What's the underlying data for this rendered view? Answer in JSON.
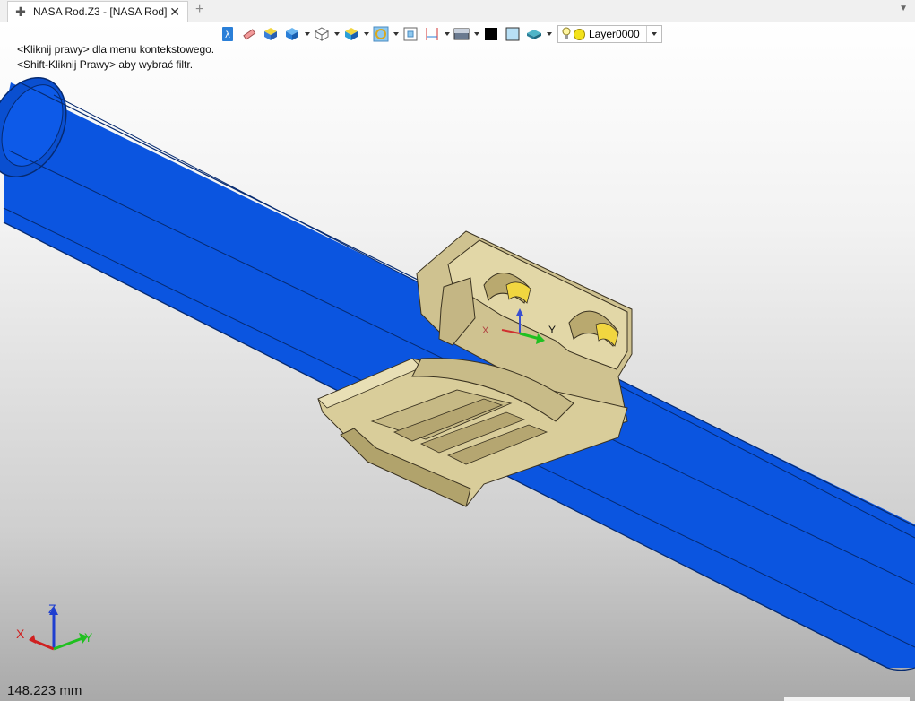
{
  "tab": {
    "title": "NASA Rod.Z3 - [NASA Rod]",
    "pin_icon": "plus-pin-icon",
    "close_icon": "close-icon",
    "new_tab_icon": "plus-icon"
  },
  "toolbar": {
    "buttons": [
      "walk-view-icon",
      "eraser-icon",
      "shaded-solid-icon",
      "shaded-cube-icon",
      "wireframe-cube-icon",
      "section-cube-icon",
      "circle-view-icon",
      "zoom-fit-icon",
      "dimension-icon",
      "background-icon",
      "black-color-swatch",
      "light-blue-color-swatch",
      "surface-material-icon"
    ],
    "layer": {
      "name": "Layer0000",
      "bulb_icon": "lightbulb-icon",
      "sun_icon": "layer-active-icon"
    }
  },
  "hints": {
    "line1": "<Kliknij prawy> dla menu kontekstowego.",
    "line2": "<Shift-Kliknij Prawy> aby wybrać filtr."
  },
  "triad": {
    "x": "X",
    "y": "Y",
    "z": "Z"
  },
  "part_triad": {
    "x": "X",
    "y": "Y"
  },
  "status": {
    "dimension": "148.223 mm"
  },
  "colors": {
    "rod": "#0b55e0",
    "rod_dark": "#083d9e",
    "part": "#cdbf8e",
    "part_dark": "#8f7f4c",
    "part_highlight": "#f1d640"
  }
}
